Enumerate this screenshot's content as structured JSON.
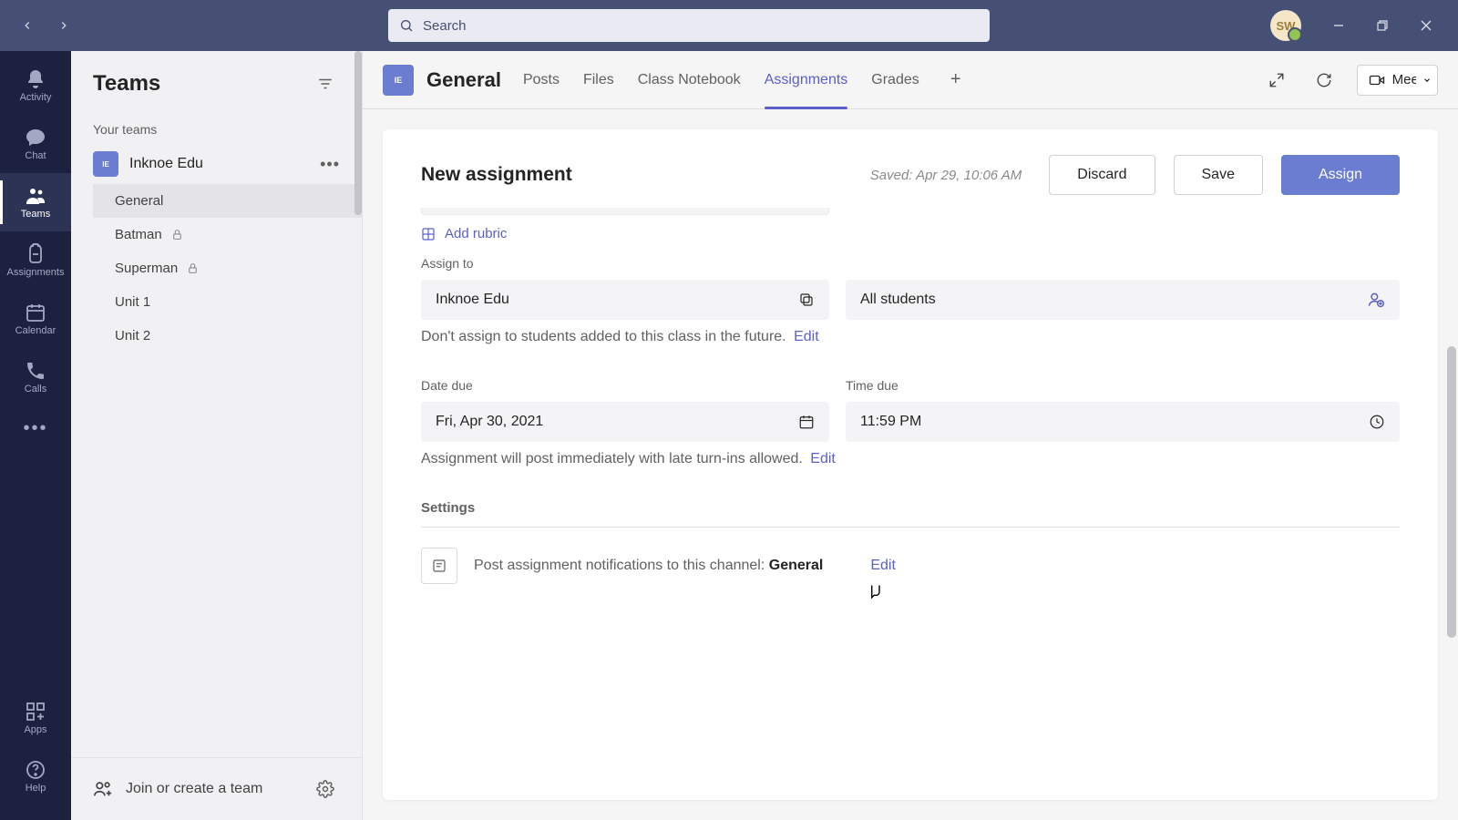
{
  "titlebar": {
    "search_placeholder": "Search",
    "avatar_initials": "SW"
  },
  "rail": {
    "items": [
      {
        "label": "Activity"
      },
      {
        "label": "Chat"
      },
      {
        "label": "Teams"
      },
      {
        "label": "Assignments"
      },
      {
        "label": "Calendar"
      },
      {
        "label": "Calls"
      }
    ],
    "apps_label": "Apps",
    "help_label": "Help"
  },
  "sidebar": {
    "title": "Teams",
    "group_label": "Your teams",
    "team_name": "Inknoe Edu",
    "channels": [
      {
        "label": "General"
      },
      {
        "label": "Batman"
      },
      {
        "label": "Superman"
      },
      {
        "label": "Unit 1"
      },
      {
        "label": "Unit 2"
      }
    ],
    "join_label": "Join or create a team"
  },
  "content_header": {
    "channel_title": "General",
    "tabs": [
      {
        "label": "Posts"
      },
      {
        "label": "Files"
      },
      {
        "label": "Class Notebook"
      },
      {
        "label": "Assignments"
      },
      {
        "label": "Grades"
      }
    ],
    "meet_label": "Meet"
  },
  "assignment": {
    "title": "New assignment",
    "saved_text": "Saved: Apr 29, 10:06 AM",
    "discard_label": "Discard",
    "save_label": "Save",
    "assign_label": "Assign",
    "add_rubric_label": "Add rubric",
    "assign_to_label": "Assign to",
    "class_value": "Inknoe Edu",
    "students_value": "All students",
    "future_note": "Don't assign to students added to this class in the future.",
    "edit_label": "Edit",
    "date_due_label": "Date due",
    "time_due_label": "Time due",
    "date_value": "Fri, Apr 30, 2021",
    "time_value": "11:59 PM",
    "post_note": "Assignment will post immediately with late turn-ins allowed.",
    "settings_label": "Settings",
    "notify_text": "Post assignment notifications to this channel:",
    "notify_channel": "General"
  }
}
